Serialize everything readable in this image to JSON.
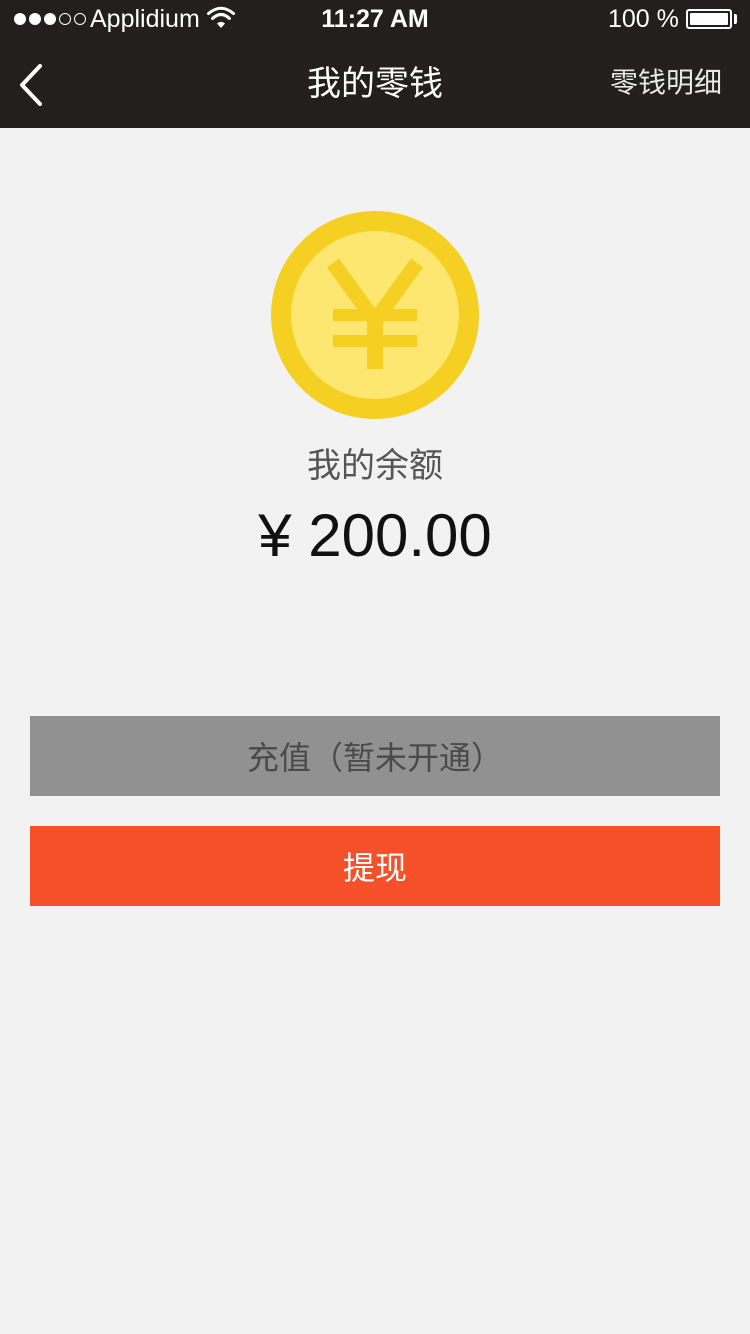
{
  "status_bar": {
    "carrier": "Applidium",
    "time": "11:27 AM",
    "battery": "100 %",
    "signal_bars_filled": 3,
    "signal_bars_total": 5
  },
  "nav": {
    "title": "我的零钱",
    "right_link": "零钱明细",
    "back_icon": "chevron-left-icon"
  },
  "balance": {
    "coin_icon": "yuan-coin-icon",
    "label": "我的余额",
    "amount": "¥ 200.00"
  },
  "actions": {
    "recharge_label": "充值（暂未开通）",
    "withdraw_label": "提现"
  },
  "colors": {
    "top_bar": "#231f1e",
    "background": "#f2f2f2",
    "coin_outer": "#f5cf22",
    "coin_inner": "#fde771",
    "recharge_button": "#919191",
    "withdraw_button": "#f5502a"
  }
}
